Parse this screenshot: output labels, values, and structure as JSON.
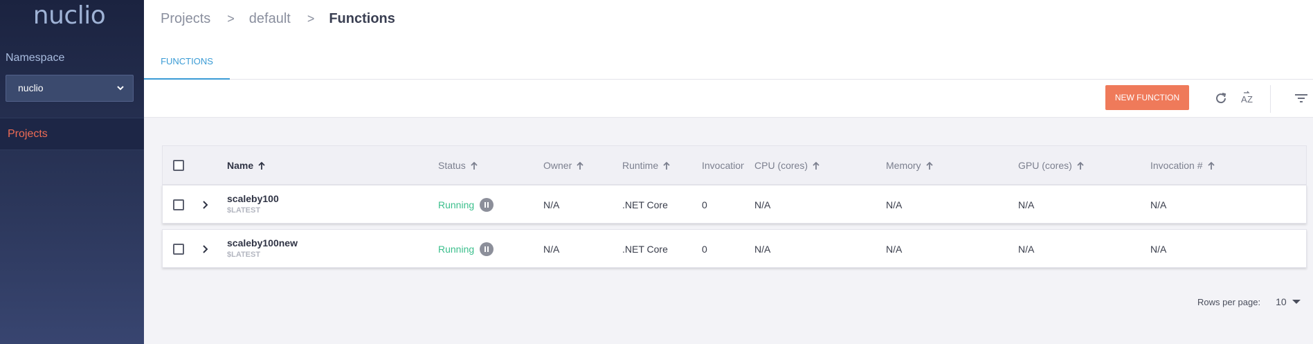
{
  "sidebar": {
    "logo": "nuclio",
    "namespace_label": "Namespace",
    "namespace_value": "nuclio",
    "nav": [
      {
        "label": "Projects"
      }
    ]
  },
  "header": {
    "breadcrumb": [
      "Projects",
      "default",
      "Functions"
    ],
    "separator": ">",
    "tab": "FUNCTIONS"
  },
  "toolbar": {
    "new_function_label": "NEW FUNCTION",
    "icons": [
      "refresh-icon",
      "sort-az-icon",
      "filter-icon"
    ]
  },
  "table": {
    "columns": [
      "Name",
      "Status",
      "Owner",
      "Runtime",
      "Invocation",
      "CPU (cores)",
      "Memory",
      "GPU (cores)",
      "Invocation #"
    ],
    "rows": [
      {
        "name": "scaleby100",
        "version": "$LATEST",
        "status": "Running",
        "owner": "N/A",
        "runtime": ".NET Core",
        "invocation": "0",
        "cpu": "N/A",
        "memory": "N/A",
        "gpu": "N/A",
        "invocation_count": "N/A"
      },
      {
        "name": "scaleby100new",
        "version": "$LATEST",
        "status": "Running",
        "owner": "N/A",
        "runtime": ".NET Core",
        "invocation": "0",
        "cpu": "N/A",
        "memory": "N/A",
        "gpu": "N/A",
        "invocation_count": "N/A"
      }
    ]
  },
  "pagination": {
    "rows_per_page_label": "Rows per page:",
    "rows_per_page_value": "10"
  },
  "colors": {
    "accent": "#3a9bd5",
    "primary_button": "#ef7a5a",
    "active_nav": "#ef6c55",
    "running": "#3bbf8c"
  }
}
